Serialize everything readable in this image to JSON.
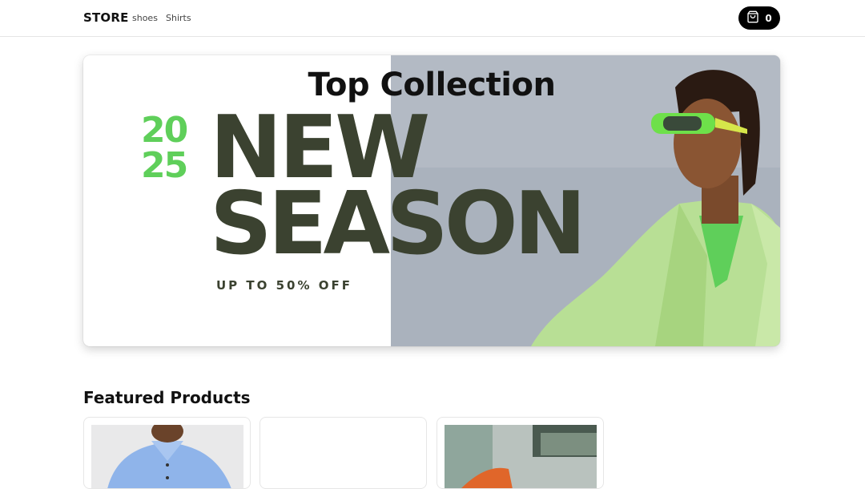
{
  "header": {
    "brand": "STORE",
    "nav": [
      {
        "label": "shoes"
      },
      {
        "label": "Shirts"
      }
    ],
    "cart": {
      "count": "0",
      "icon": "shopping-bag-icon"
    }
  },
  "hero": {
    "title": "Top Collection",
    "year_top": "20",
    "year_bottom": "25",
    "headline_line1": "NEW",
    "headline_line2": "SEASON",
    "offer": "UP TO 50% OFF",
    "colors": {
      "accent": "#5fcf5a",
      "headline": "#3b4230",
      "photo_bg": "#aab2bd"
    }
  },
  "featured": {
    "title": "Featured Products",
    "products": [
      {
        "image": "blue-shirt-photo"
      },
      {
        "image": "blank-product-photo"
      },
      {
        "image": "shoe-photo"
      }
    ]
  }
}
